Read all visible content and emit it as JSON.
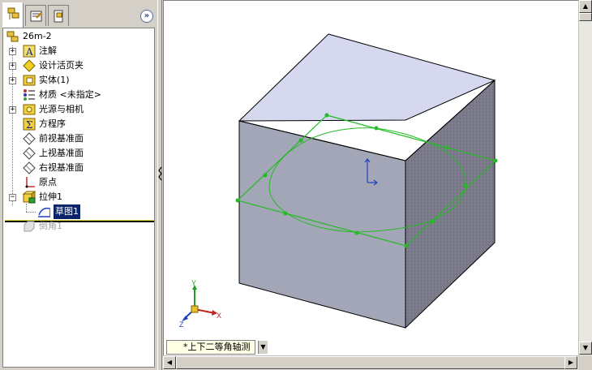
{
  "panel": {
    "tabs": [
      "FeatureManager design tree",
      "PropertyManager",
      "ConfigurationManager"
    ],
    "collapse_glyph": "»"
  },
  "tree": {
    "root": "26m-2",
    "items": [
      {
        "label": "注解",
        "icon": "annotations-icon",
        "expandable": true
      },
      {
        "label": "设计活页夹",
        "icon": "design-binder-icon",
        "expandable": true
      },
      {
        "label": "实体(1)",
        "icon": "solid-bodies-icon",
        "expandable": true
      },
      {
        "label": "材质 <未指定>",
        "icon": "material-icon",
        "expandable": false
      },
      {
        "label": "光源与相机",
        "icon": "lights-cameras-icon",
        "expandable": true
      },
      {
        "label": "方程序",
        "icon": "equations-icon",
        "expandable": false
      },
      {
        "label": "前视基准面",
        "icon": "plane-icon",
        "expandable": false
      },
      {
        "label": "上视基准面",
        "icon": "plane-icon",
        "expandable": false
      },
      {
        "label": "右视基准面",
        "icon": "plane-icon",
        "expandable": false
      },
      {
        "label": "原点",
        "icon": "origin-icon",
        "expandable": false
      },
      {
        "label": "拉伸1",
        "icon": "extrude-icon",
        "expandable": true,
        "expand_glyph": "−"
      },
      {
        "label": "草图1",
        "icon": "sketch-icon",
        "selected": true
      },
      {
        "label": "倒角1",
        "icon": "chamfer-icon",
        "suppressed": true
      }
    ]
  },
  "viewport": {
    "orientation_label": "*上下二等角轴测",
    "triad": {
      "x": "X",
      "y": "Y",
      "z": "Z"
    }
  },
  "colors": {
    "cube_top": "#d6d9ee",
    "cube_front": "#a3a6b4",
    "cube_side": "#777786",
    "sketch_green": "#22bb22",
    "selection": "#0a246a"
  }
}
